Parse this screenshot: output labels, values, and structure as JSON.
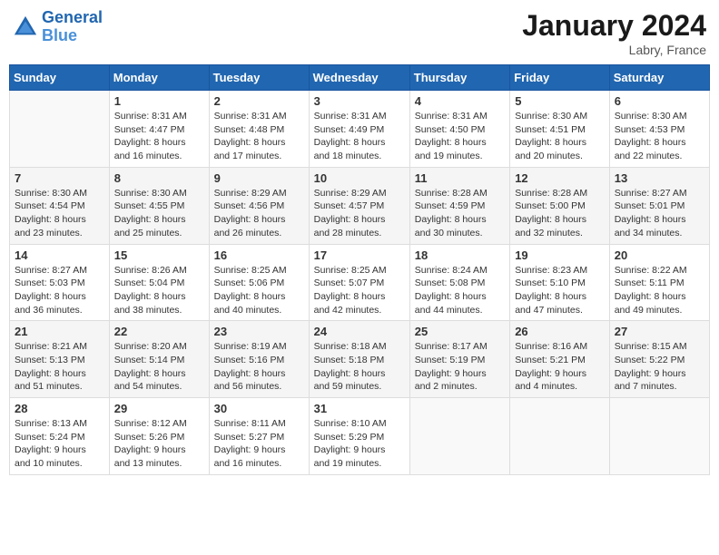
{
  "header": {
    "logo_line1": "General",
    "logo_line2": "Blue",
    "month_title": "January 2024",
    "location": "Labry, France"
  },
  "weekdays": [
    "Sunday",
    "Monday",
    "Tuesday",
    "Wednesday",
    "Thursday",
    "Friday",
    "Saturday"
  ],
  "weeks": [
    [
      {
        "day": "",
        "sunrise": "",
        "sunset": "",
        "daylight": ""
      },
      {
        "day": "1",
        "sunrise": "Sunrise: 8:31 AM",
        "sunset": "Sunset: 4:47 PM",
        "daylight": "Daylight: 8 hours and 16 minutes."
      },
      {
        "day": "2",
        "sunrise": "Sunrise: 8:31 AM",
        "sunset": "Sunset: 4:48 PM",
        "daylight": "Daylight: 8 hours and 17 minutes."
      },
      {
        "day": "3",
        "sunrise": "Sunrise: 8:31 AM",
        "sunset": "Sunset: 4:49 PM",
        "daylight": "Daylight: 8 hours and 18 minutes."
      },
      {
        "day": "4",
        "sunrise": "Sunrise: 8:31 AM",
        "sunset": "Sunset: 4:50 PM",
        "daylight": "Daylight: 8 hours and 19 minutes."
      },
      {
        "day": "5",
        "sunrise": "Sunrise: 8:30 AM",
        "sunset": "Sunset: 4:51 PM",
        "daylight": "Daylight: 8 hours and 20 minutes."
      },
      {
        "day": "6",
        "sunrise": "Sunrise: 8:30 AM",
        "sunset": "Sunset: 4:53 PM",
        "daylight": "Daylight: 8 hours and 22 minutes."
      }
    ],
    [
      {
        "day": "7",
        "sunrise": "Sunrise: 8:30 AM",
        "sunset": "Sunset: 4:54 PM",
        "daylight": "Daylight: 8 hours and 23 minutes."
      },
      {
        "day": "8",
        "sunrise": "Sunrise: 8:30 AM",
        "sunset": "Sunset: 4:55 PM",
        "daylight": "Daylight: 8 hours and 25 minutes."
      },
      {
        "day": "9",
        "sunrise": "Sunrise: 8:29 AM",
        "sunset": "Sunset: 4:56 PM",
        "daylight": "Daylight: 8 hours and 26 minutes."
      },
      {
        "day": "10",
        "sunrise": "Sunrise: 8:29 AM",
        "sunset": "Sunset: 4:57 PM",
        "daylight": "Daylight: 8 hours and 28 minutes."
      },
      {
        "day": "11",
        "sunrise": "Sunrise: 8:28 AM",
        "sunset": "Sunset: 4:59 PM",
        "daylight": "Daylight: 8 hours and 30 minutes."
      },
      {
        "day": "12",
        "sunrise": "Sunrise: 8:28 AM",
        "sunset": "Sunset: 5:00 PM",
        "daylight": "Daylight: 8 hours and 32 minutes."
      },
      {
        "day": "13",
        "sunrise": "Sunrise: 8:27 AM",
        "sunset": "Sunset: 5:01 PM",
        "daylight": "Daylight: 8 hours and 34 minutes."
      }
    ],
    [
      {
        "day": "14",
        "sunrise": "Sunrise: 8:27 AM",
        "sunset": "Sunset: 5:03 PM",
        "daylight": "Daylight: 8 hours and 36 minutes."
      },
      {
        "day": "15",
        "sunrise": "Sunrise: 8:26 AM",
        "sunset": "Sunset: 5:04 PM",
        "daylight": "Daylight: 8 hours and 38 minutes."
      },
      {
        "day": "16",
        "sunrise": "Sunrise: 8:25 AM",
        "sunset": "Sunset: 5:06 PM",
        "daylight": "Daylight: 8 hours and 40 minutes."
      },
      {
        "day": "17",
        "sunrise": "Sunrise: 8:25 AM",
        "sunset": "Sunset: 5:07 PM",
        "daylight": "Daylight: 8 hours and 42 minutes."
      },
      {
        "day": "18",
        "sunrise": "Sunrise: 8:24 AM",
        "sunset": "Sunset: 5:08 PM",
        "daylight": "Daylight: 8 hours and 44 minutes."
      },
      {
        "day": "19",
        "sunrise": "Sunrise: 8:23 AM",
        "sunset": "Sunset: 5:10 PM",
        "daylight": "Daylight: 8 hours and 47 minutes."
      },
      {
        "day": "20",
        "sunrise": "Sunrise: 8:22 AM",
        "sunset": "Sunset: 5:11 PM",
        "daylight": "Daylight: 8 hours and 49 minutes."
      }
    ],
    [
      {
        "day": "21",
        "sunrise": "Sunrise: 8:21 AM",
        "sunset": "Sunset: 5:13 PM",
        "daylight": "Daylight: 8 hours and 51 minutes."
      },
      {
        "day": "22",
        "sunrise": "Sunrise: 8:20 AM",
        "sunset": "Sunset: 5:14 PM",
        "daylight": "Daylight: 8 hours and 54 minutes."
      },
      {
        "day": "23",
        "sunrise": "Sunrise: 8:19 AM",
        "sunset": "Sunset: 5:16 PM",
        "daylight": "Daylight: 8 hours and 56 minutes."
      },
      {
        "day": "24",
        "sunrise": "Sunrise: 8:18 AM",
        "sunset": "Sunset: 5:18 PM",
        "daylight": "Daylight: 8 hours and 59 minutes."
      },
      {
        "day": "25",
        "sunrise": "Sunrise: 8:17 AM",
        "sunset": "Sunset: 5:19 PM",
        "daylight": "Daylight: 9 hours and 2 minutes."
      },
      {
        "day": "26",
        "sunrise": "Sunrise: 8:16 AM",
        "sunset": "Sunset: 5:21 PM",
        "daylight": "Daylight: 9 hours and 4 minutes."
      },
      {
        "day": "27",
        "sunrise": "Sunrise: 8:15 AM",
        "sunset": "Sunset: 5:22 PM",
        "daylight": "Daylight: 9 hours and 7 minutes."
      }
    ],
    [
      {
        "day": "28",
        "sunrise": "Sunrise: 8:13 AM",
        "sunset": "Sunset: 5:24 PM",
        "daylight": "Daylight: 9 hours and 10 minutes."
      },
      {
        "day": "29",
        "sunrise": "Sunrise: 8:12 AM",
        "sunset": "Sunset: 5:26 PM",
        "daylight": "Daylight: 9 hours and 13 minutes."
      },
      {
        "day": "30",
        "sunrise": "Sunrise: 8:11 AM",
        "sunset": "Sunset: 5:27 PM",
        "daylight": "Daylight: 9 hours and 16 minutes."
      },
      {
        "day": "31",
        "sunrise": "Sunrise: 8:10 AM",
        "sunset": "Sunset: 5:29 PM",
        "daylight": "Daylight: 9 hours and 19 minutes."
      },
      {
        "day": "",
        "sunrise": "",
        "sunset": "",
        "daylight": ""
      },
      {
        "day": "",
        "sunrise": "",
        "sunset": "",
        "daylight": ""
      },
      {
        "day": "",
        "sunrise": "",
        "sunset": "",
        "daylight": ""
      }
    ]
  ]
}
